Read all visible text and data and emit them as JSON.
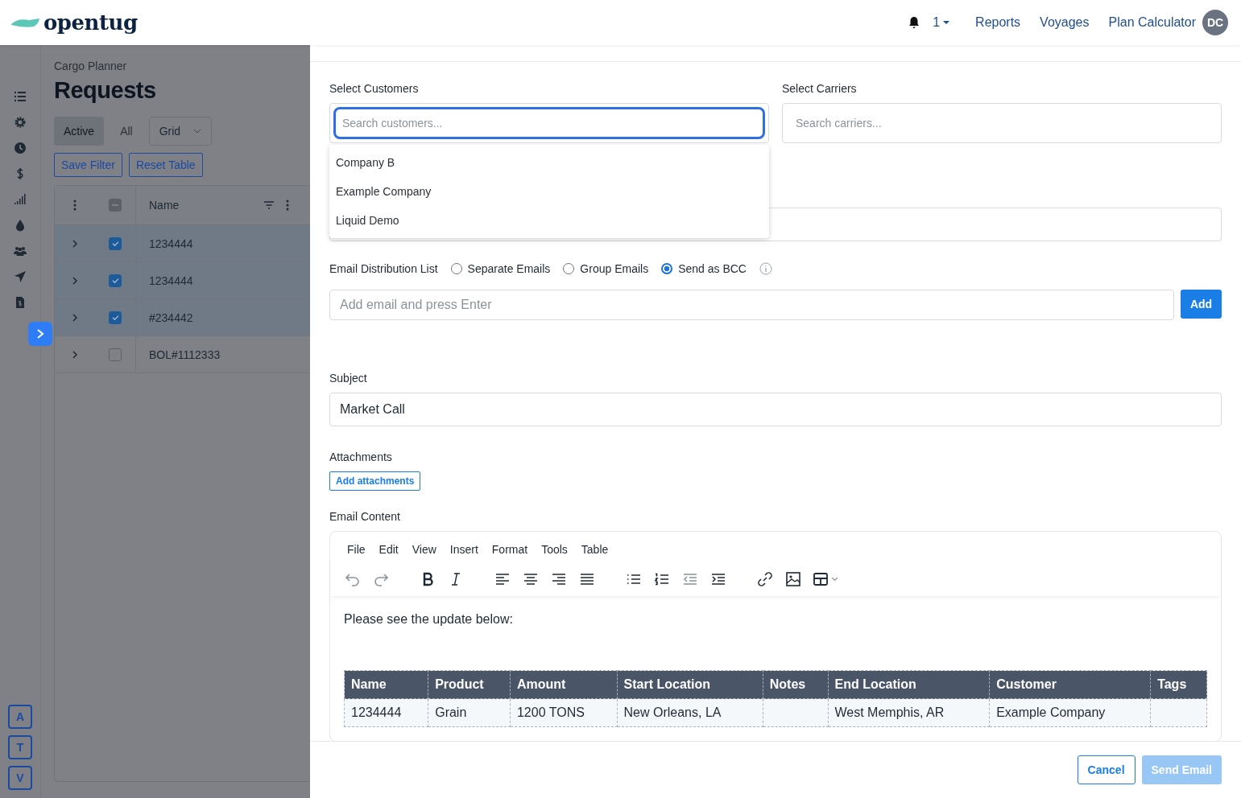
{
  "header": {
    "logo": "opentug",
    "notifications": "1",
    "links": [
      {
        "label": "Reports"
      },
      {
        "label": "Voyages"
      },
      {
        "label": "Plan Calculator"
      }
    ],
    "avatar": "DC"
  },
  "page": {
    "breadcrumb": "Cargo Planner",
    "title": "Requests",
    "tabs": [
      {
        "label": "Active",
        "selected": true
      },
      {
        "label": "All",
        "selected": false
      }
    ],
    "view_select": "Grid",
    "buttons": [
      "Save Filter",
      "Reset Table"
    ],
    "table": {
      "select_all": {
        "indeterminate": true
      },
      "name_column": "Name",
      "rows": [
        {
          "name": "1234444",
          "checked": true
        },
        {
          "name": "1234444",
          "checked": true
        },
        {
          "name": "#234442",
          "checked": true
        },
        {
          "name": "BOL#1112333",
          "checked": false
        }
      ]
    },
    "rail_buttons": [
      "A",
      "T",
      "V"
    ]
  },
  "form": {
    "customers": {
      "label": "Select Customers",
      "placeholder": "Search customers...",
      "options": [
        "Company B",
        "Example Company",
        "Liquid Demo"
      ]
    },
    "carriers": {
      "label": "Select Carriers",
      "placeholder": "Search carriers..."
    },
    "distribution": {
      "label": "Email Distribution List",
      "options": [
        {
          "label": "Separate Emails",
          "selected": false
        },
        {
          "label": "Group Emails",
          "selected": false
        },
        {
          "label": "Send as BCC",
          "selected": true
        }
      ]
    },
    "email": {
      "placeholder": "Add email and press Enter",
      "button": "Add"
    },
    "subject": {
      "label": "Subject",
      "value": "Market Call"
    },
    "attachments": {
      "label": "Attachments",
      "button": "Add attachments"
    },
    "content": {
      "label": "Email Content",
      "menu": [
        "File",
        "Edit",
        "View",
        "Insert",
        "Format",
        "Tools",
        "Table"
      ],
      "toolbar": [
        [
          {
            "kind": "undo",
            "disabled": true
          },
          {
            "kind": "redo",
            "disabled": true
          }
        ],
        [
          {
            "kind": "bold",
            "disabled": false
          },
          {
            "kind": "italic",
            "disabled": false
          }
        ],
        [
          {
            "kind": "align-left",
            "disabled": false
          },
          {
            "kind": "align-center",
            "disabled": false
          },
          {
            "kind": "align-right",
            "disabled": false
          },
          {
            "kind": "justify",
            "disabled": false
          }
        ],
        [
          {
            "kind": "bullet-list",
            "disabled": false
          },
          {
            "kind": "number-list",
            "disabled": false
          },
          {
            "kind": "outdent",
            "disabled": true
          },
          {
            "kind": "indent",
            "disabled": false
          }
        ],
        [
          {
            "kind": "link",
            "disabled": false
          },
          {
            "kind": "image",
            "disabled": false
          },
          {
            "kind": "table",
            "disabled": false
          }
        ]
      ],
      "text": "Please see the update below:",
      "table": {
        "columns": [
          "Name",
          "Product",
          "Amount",
          "Start Location",
          "Notes",
          "End Location",
          "Customer",
          "Tags"
        ],
        "rows": [
          [
            "1234444",
            "Grain",
            "1200 TONS",
            "New Orleans, LA",
            "",
            "West Memphis, AR",
            "Example Company",
            ""
          ]
        ]
      }
    }
  },
  "footer": {
    "cancel": "Cancel",
    "send": {
      "label": "Send Email",
      "disabled": true
    }
  }
}
